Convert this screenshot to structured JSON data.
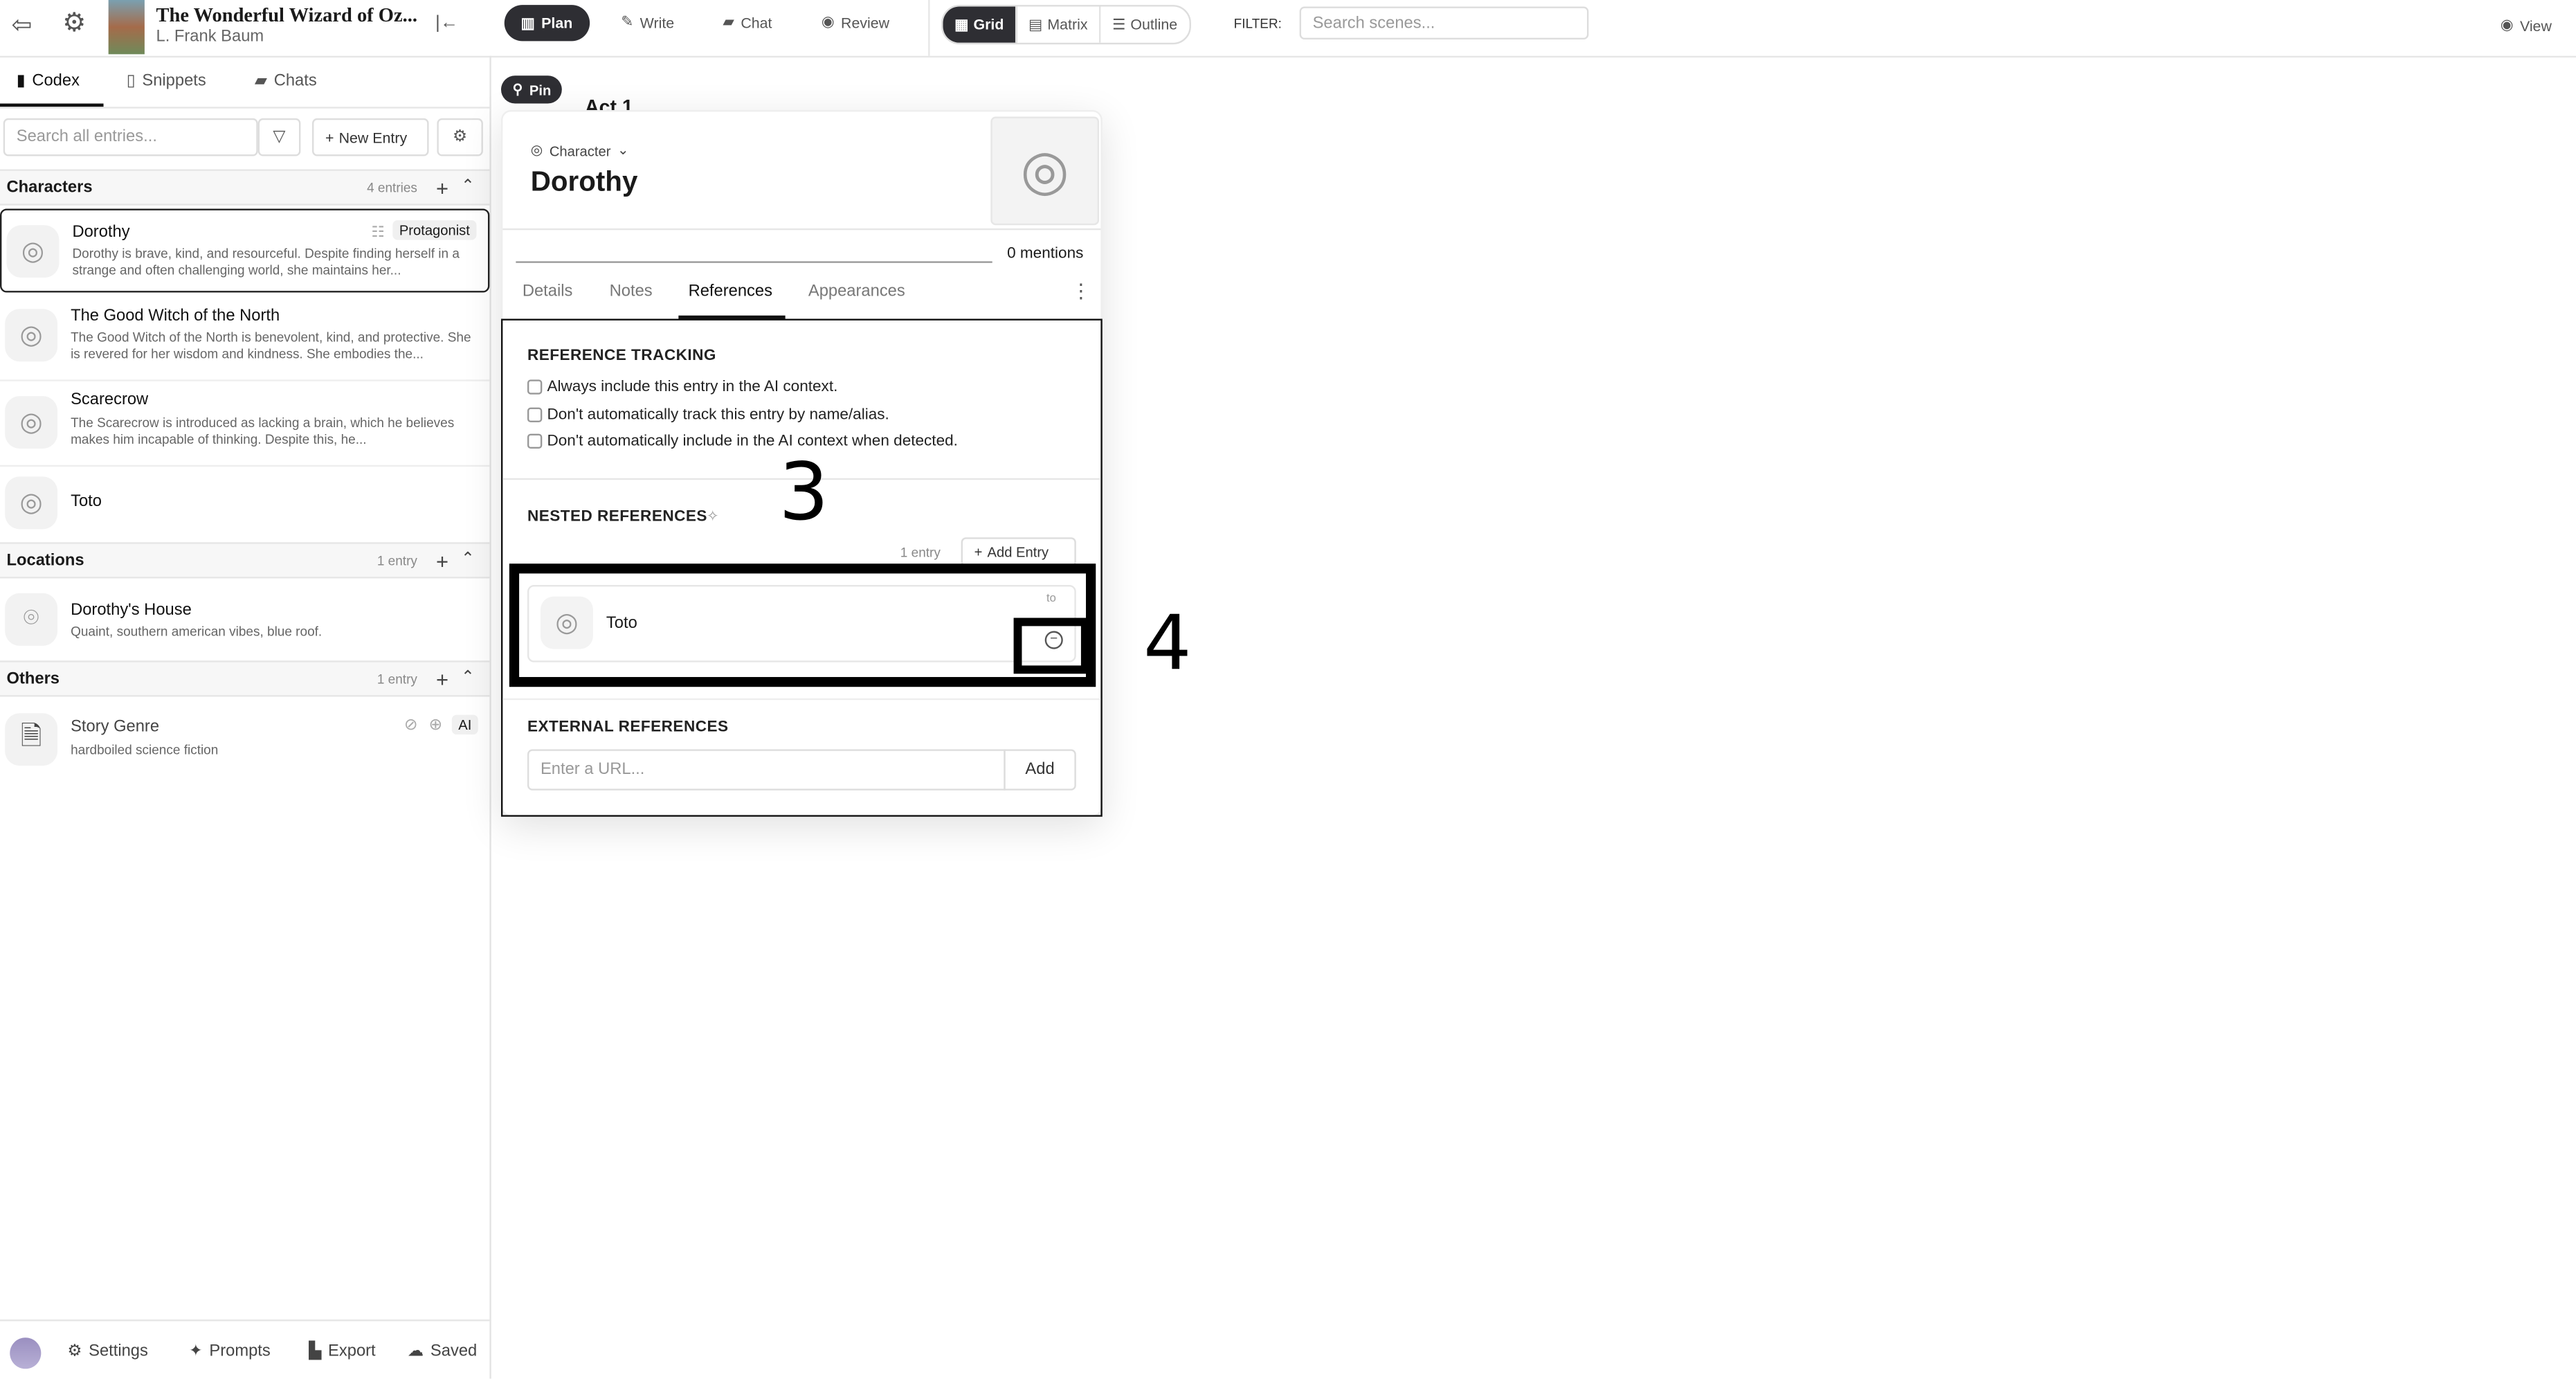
{
  "header": {
    "book_title": "The Wonderful Wizard of Oz...",
    "author": "L. Frank Baum"
  },
  "main_nav": [
    {
      "label": "Plan",
      "active": true
    },
    {
      "label": "Write"
    },
    {
      "label": "Chat"
    },
    {
      "label": "Review"
    }
  ],
  "view_modes": [
    {
      "label": "Grid",
      "active": true
    },
    {
      "label": "Matrix"
    },
    {
      "label": "Outline"
    }
  ],
  "filter": {
    "label": "FILTER:",
    "placeholder": "Search scenes..."
  },
  "view_label": "View",
  "sidebar": {
    "tabs": [
      {
        "label": "Codex",
        "active": true
      },
      {
        "label": "Snippets"
      },
      {
        "label": "Chats"
      }
    ],
    "search_placeholder": "Search all entries...",
    "new_entry": "New Entry",
    "sections": [
      {
        "title": "Characters",
        "count": "4 entries",
        "items": [
          {
            "name": "Dorothy",
            "tag": "Protagonist",
            "desc": "Dorothy is brave, kind, and resourceful. Despite finding herself in a strange and often challenging world, she maintains her...",
            "selected": true
          },
          {
            "name": "The Good Witch of the North",
            "desc": "The Good Witch of the North is benevolent, kind, and protective. She is revered for her wisdom and kindness. She embodies the..."
          },
          {
            "name": "Scarecrow",
            "desc": "The Scarecrow is introduced as lacking a brain, which he believes makes him incapable of thinking. Despite this, he..."
          },
          {
            "name": "Toto",
            "desc": ""
          }
        ]
      },
      {
        "title": "Locations",
        "count": "1 entry",
        "items": [
          {
            "name": "Dorothy's House",
            "desc": "Quaint, southern american vibes, blue roof."
          }
        ]
      },
      {
        "title": "Others",
        "count": "1 entry",
        "items": [
          {
            "name": "Story Genre",
            "desc": "hardboiled science fiction",
            "badge": "AI"
          }
        ]
      }
    ],
    "footer": {
      "settings": "Settings",
      "prompts": "Prompts",
      "export": "Export",
      "saved": "Saved"
    }
  },
  "canvas": {
    "pin": "Pin",
    "act": "Act 1"
  },
  "popup": {
    "type": "Character",
    "name": "Dorothy",
    "mentions": "0 mentions",
    "tabs": [
      {
        "label": "Details"
      },
      {
        "label": "Notes"
      },
      {
        "label": "References",
        "active": true
      },
      {
        "label": "Appearances"
      }
    ],
    "tracking": {
      "title": "REFERENCE TRACKING",
      "options": [
        "Always include this entry in the AI context.",
        "Don't automatically track this entry by name/alias.",
        "Don't automatically include in the AI context when detected."
      ]
    },
    "nested": {
      "title": "NESTED REFERENCES",
      "count": "1 entry",
      "add": "Add Entry",
      "entries": [
        {
          "name": "Toto",
          "hint": "to"
        }
      ]
    },
    "external": {
      "title": "EXTERNAL REFERENCES",
      "placeholder": "Enter a URL...",
      "add": "Add"
    }
  },
  "annotations": [
    "3",
    "4"
  ]
}
